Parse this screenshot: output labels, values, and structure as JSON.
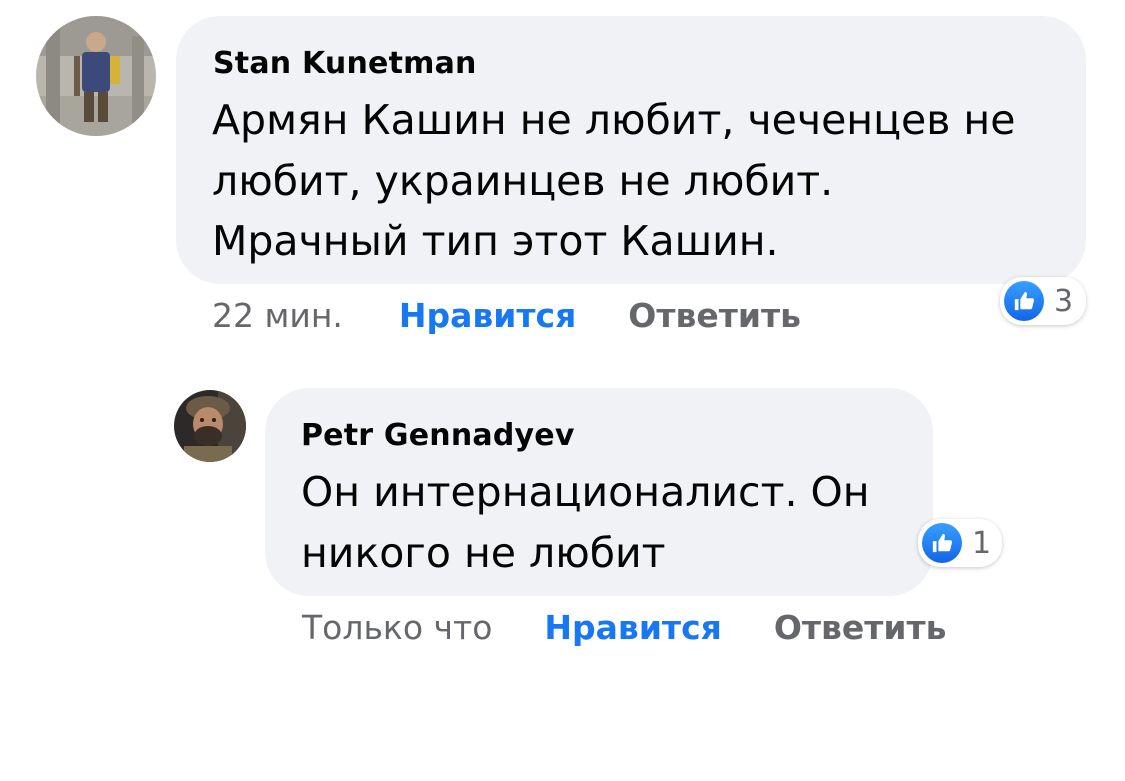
{
  "comments": [
    {
      "author": "Stan Kunetman",
      "text_lines": [
        "Армян Кашин не любит, чеченцев не",
        "любит, украинцев не любит.",
        "Мрачный тип этот Кашин."
      ],
      "time": "22 мин.",
      "like_label": "Нравится",
      "reply_label": "Ответить",
      "reaction_icon": "thumbs-up-icon",
      "reaction_count": "3"
    },
    {
      "author": "Petr Gennadyev",
      "text_lines": [
        "Он интернационалист. Он",
        "никого не любит"
      ],
      "time": "Только что",
      "like_label": "Нравится",
      "reply_label": "Ответить",
      "reaction_icon": "thumbs-up-icon",
      "reaction_count": "1"
    }
  ],
  "colors": {
    "bubble": "#f0f2f5",
    "text": "#050505",
    "muted": "#65676b",
    "like_blue": "#1877f2"
  }
}
